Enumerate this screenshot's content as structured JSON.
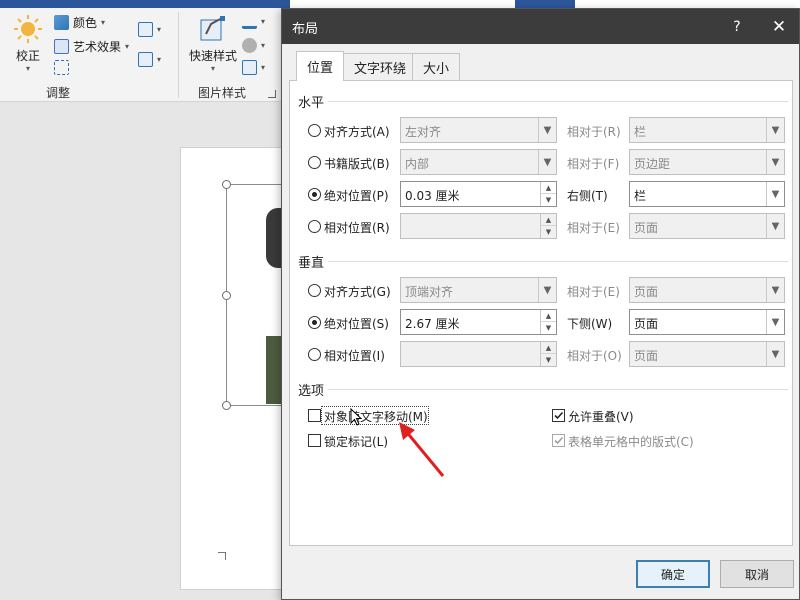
{
  "ribbon": {
    "groups": {
      "adjust_label": "调整",
      "picture_styles_label": "图片样式"
    },
    "buttons": {
      "correct": "校正",
      "color": "颜色",
      "artistic": "艺术效果",
      "quick_styles": "快速样式"
    }
  },
  "dialog": {
    "title": "布局",
    "help": "?",
    "close": "✕",
    "tabs": [
      "位置",
      "文字环绕",
      "大小"
    ],
    "horizontal": {
      "label": "水平",
      "rows": [
        {
          "option": "对齐方式(A)",
          "value": "左对齐",
          "relative_label": "相对于(R)",
          "relative_value": "栏"
        },
        {
          "option": "书籍版式(B)",
          "value": "内部",
          "relative_label": "相对于(F)",
          "relative_value": "页边距"
        },
        {
          "option": "绝对位置(P)",
          "value": "0.03 厘米",
          "relative_label": "右侧(T)",
          "relative_value": "栏"
        },
        {
          "option": "相对位置(R)",
          "value": "",
          "relative_label": "相对于(E)",
          "relative_value": "页面"
        }
      ]
    },
    "vertical": {
      "label": "垂直",
      "rows": [
        {
          "option": "对齐方式(G)",
          "value": "顶端对齐",
          "relative_label": "相对于(E)",
          "relative_value": "页面"
        },
        {
          "option": "绝对位置(S)",
          "value": "2.67 厘米",
          "relative_label": "下侧(W)",
          "relative_value": "页面"
        },
        {
          "option": "相对位置(I)",
          "value": "",
          "relative_label": "相对于(O)",
          "relative_value": "页面"
        }
      ]
    },
    "options": {
      "label": "选项",
      "move_with_text": "对象随文字移动(M)",
      "lock_anchor": "锁定标记(L)",
      "allow_overlap": "允许重叠(V)",
      "layout_in_cell": "表格单元格中的版式(C)"
    },
    "buttons": {
      "ok": "确定",
      "cancel": "取消"
    }
  },
  "colors": {
    "title_bar": "#3c3c3c",
    "word_blue": "#2b579a",
    "annotation_arrow": "#e02020",
    "default_button_border": "#3c7fb1"
  }
}
